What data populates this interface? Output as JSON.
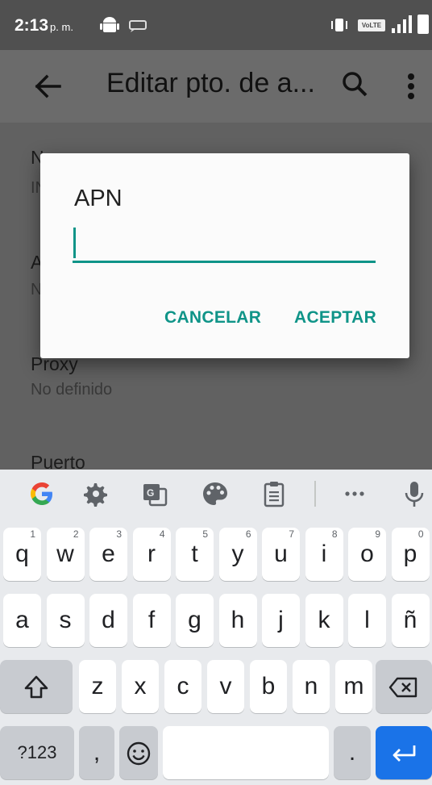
{
  "status_bar": {
    "time": "2:13",
    "ampm": "p. m.",
    "volte_label": "VoLTE"
  },
  "app_bar": {
    "title": "Editar pto. de a..."
  },
  "settings_list": {
    "items": [
      {
        "title": "N",
        "summary": "IN"
      },
      {
        "title": "A",
        "summary": "N"
      },
      {
        "title": "Proxy",
        "summary": "No definido"
      },
      {
        "title": "Puerto",
        "summary": ""
      }
    ]
  },
  "dialog": {
    "title": "APN",
    "input_value": "",
    "cancel_label": "CANCELAR",
    "accept_label": "ACEPTAR"
  },
  "keyboard": {
    "toolbar": [
      "google-icon",
      "gear-icon",
      "translate-icon",
      "palette-icon",
      "clipboard-icon",
      "more-horizontal-icon",
      "microphone-icon"
    ],
    "row1": [
      {
        "key": "q",
        "hint": "1"
      },
      {
        "key": "w",
        "hint": "2"
      },
      {
        "key": "e",
        "hint": "3"
      },
      {
        "key": "r",
        "hint": "4"
      },
      {
        "key": "t",
        "hint": "5"
      },
      {
        "key": "y",
        "hint": "6"
      },
      {
        "key": "u",
        "hint": "7"
      },
      {
        "key": "i",
        "hint": "8"
      },
      {
        "key": "o",
        "hint": "9"
      },
      {
        "key": "p",
        "hint": "0"
      }
    ],
    "row2": [
      "a",
      "s",
      "d",
      "f",
      "g",
      "h",
      "j",
      "k",
      "l",
      "ñ"
    ],
    "row3": [
      "z",
      "x",
      "c",
      "v",
      "b",
      "n",
      "m"
    ],
    "symbols_label": "?123",
    "comma_label": ",",
    "period_label": ".",
    "colors": {
      "accent": "#0f9488",
      "enter": "#1a73e8"
    }
  }
}
